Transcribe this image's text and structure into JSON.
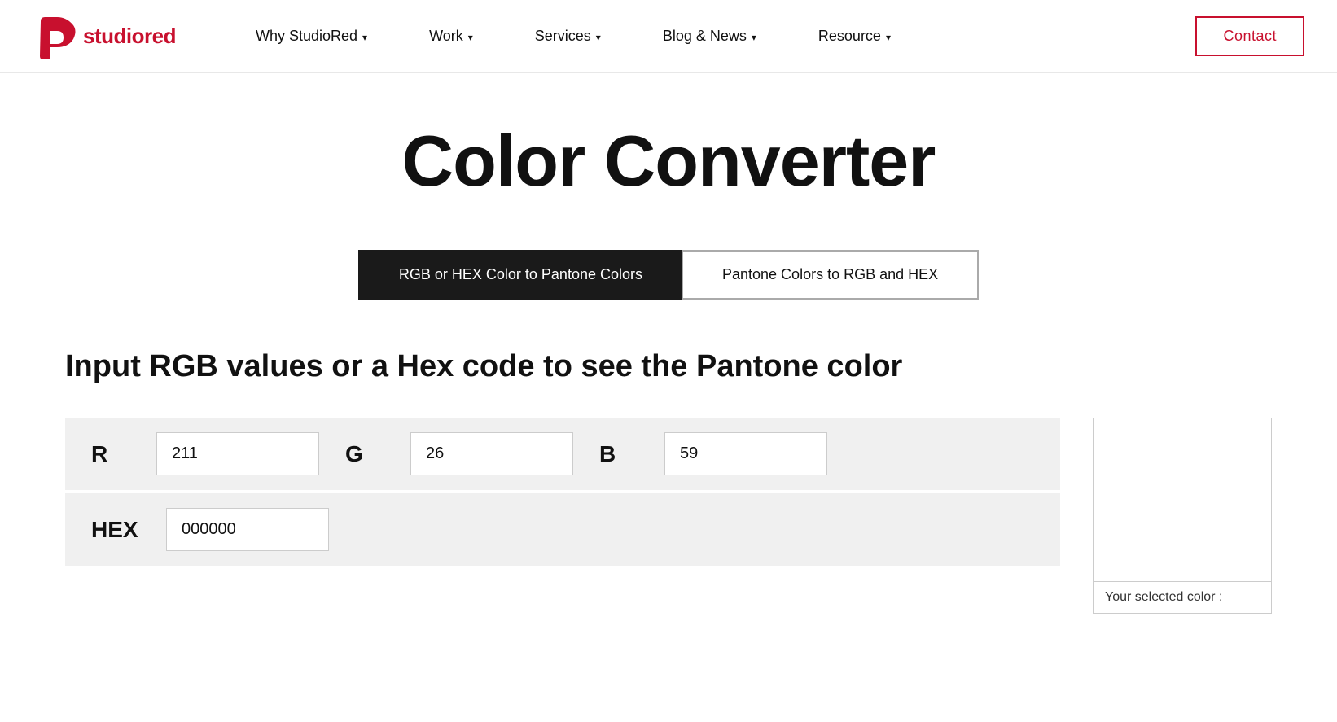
{
  "logo": {
    "text_studio": "studio",
    "text_red": "red",
    "aria": "StudioRed logo"
  },
  "nav": {
    "items": [
      {
        "label": "Why StudioRed",
        "has_chevron": true
      },
      {
        "label": "Work",
        "has_chevron": true
      },
      {
        "label": "Services",
        "has_chevron": true
      },
      {
        "label": "Blog & News",
        "has_chevron": true
      },
      {
        "label": "Resource",
        "has_chevron": true
      }
    ],
    "contact_label": "Contact"
  },
  "page": {
    "title": "Color Converter",
    "tabs": [
      {
        "label": "RGB or HEX Color to Pantone Colors",
        "active": true
      },
      {
        "label": "Pantone Colors to RGB and HEX",
        "active": false
      }
    ],
    "subtitle": "Input RGB values or a Hex code to see the Pantone color",
    "rgb_label_r": "R",
    "rgb_label_g": "G",
    "rgb_label_b": "B",
    "rgb_value_r": "211",
    "rgb_value_g": "26",
    "rgb_value_b": "59",
    "hex_label": "HEX",
    "hex_value": "000000",
    "hex_placeholder": "000000",
    "color_selected_label": "Your selected color :"
  }
}
